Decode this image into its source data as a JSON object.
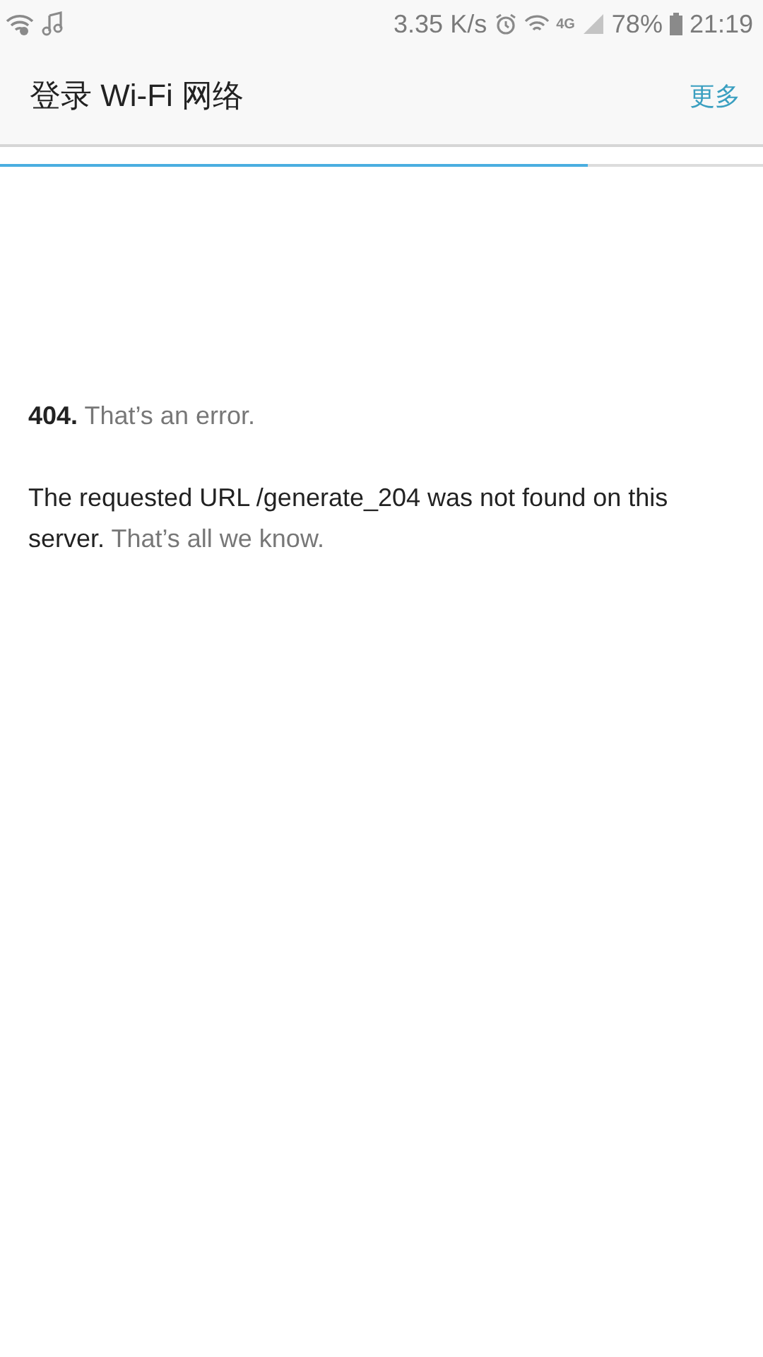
{
  "status_bar": {
    "speed": "3.35 K/s",
    "network": "4G",
    "battery": "78%",
    "time": "21:19"
  },
  "header": {
    "title": "登录 Wi-Fi 网络",
    "action": "更多"
  },
  "progress": {
    "level": 0.77
  },
  "page": {
    "code": "404.",
    "message": "That’s an error.",
    "detail": "The requested URL /generate_204 was not found on this server.",
    "note": "That’s all we know."
  }
}
